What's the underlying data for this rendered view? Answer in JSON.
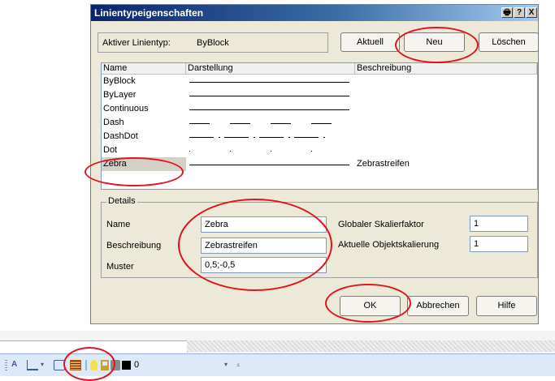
{
  "dialog": {
    "title": "Linientypeigenschaften",
    "title_buttons": [
      "🖶",
      "?",
      "X"
    ],
    "active_label": "Aktiver Linientyp:",
    "active_value": "ByBlock",
    "buttons": {
      "current": "Aktuell",
      "new": "Neu",
      "delete": "Löschen"
    },
    "columns": [
      "Name",
      "Darstellung",
      "Beschreibung"
    ],
    "linetypes": [
      {
        "name": "ByBlock",
        "pattern": "solid",
        "description": ""
      },
      {
        "name": "ByLayer",
        "pattern": "solid",
        "description": ""
      },
      {
        "name": "Continuous",
        "pattern": "solid",
        "description": ""
      },
      {
        "name": "Dash",
        "pattern": "dash",
        "description": ""
      },
      {
        "name": "DashDot",
        "pattern": "dashdot",
        "description": ""
      },
      {
        "name": "Dot",
        "pattern": "dot",
        "description": ""
      },
      {
        "name": "Zebra",
        "pattern": "solid",
        "description": "Zebrastreifen",
        "selected": true
      }
    ],
    "details": {
      "group_label": "Details",
      "name_label": "Name",
      "name_value": "Zebra",
      "desc_label": "Beschreibung",
      "desc_value": "Zebrastreifen",
      "pattern_label": "Muster",
      "pattern_value": "0,5;-0,5",
      "global_scale_label": "Globaler Skalierfaktor",
      "global_scale_value": "1",
      "object_scale_label": "Aktuelle Objektskalierung",
      "object_scale_value": "1"
    },
    "footer": {
      "ok": "OK",
      "cancel": "Abbrechen",
      "help": "Hilfe"
    }
  },
  "toolbar": {
    "layer_value": "0",
    "layer_color": "#000000"
  },
  "colors": {
    "highlight": "#e0141e",
    "title_start": "#0a246a",
    "dialog_bg": "#ece9d8"
  }
}
